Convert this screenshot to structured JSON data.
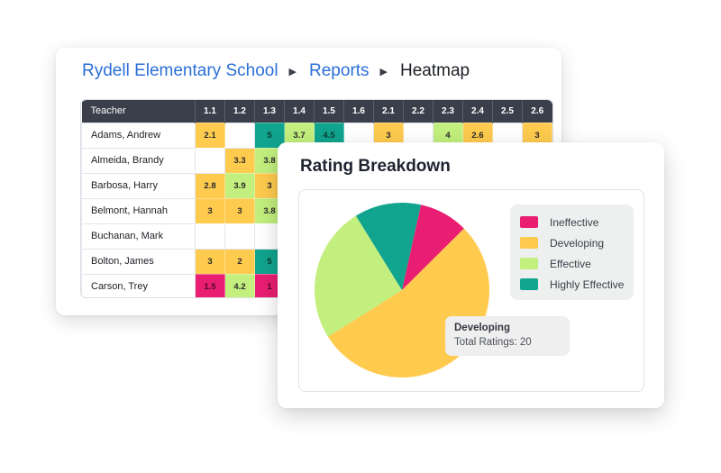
{
  "heatmap_card": {
    "breadcrumb": [
      {
        "label": "Rydell Elementary School",
        "type": "link"
      },
      {
        "label": "Reports",
        "type": "link"
      },
      {
        "label": "Heatmap",
        "type": "current"
      }
    ],
    "separator_icon": "triangle-right-icon",
    "table": {
      "teacher_header": "Teacher",
      "columns": [
        "1.1",
        "1.2",
        "1.3",
        "1.4",
        "1.5",
        "1.6",
        "2.1",
        "2.2",
        "2.3",
        "2.4",
        "2.5",
        "2.6"
      ],
      "rows": [
        {
          "teacher": "Adams, Andrew",
          "scores": [
            "2.1",
            "",
            "5",
            "3.7",
            "4.5",
            "",
            "3",
            "",
            "4",
            "2.6",
            "",
            "3"
          ]
        },
        {
          "teacher": "Almeida, Brandy",
          "scores": [
            "",
            "3.3",
            "3.8",
            "",
            "",
            "",
            "",
            "",
            "",
            "",
            "",
            ""
          ]
        },
        {
          "teacher": "Barbosa, Harry",
          "scores": [
            "2.8",
            "3.9",
            "3",
            "",
            "",
            "",
            "",
            "",
            "",
            "",
            "",
            ""
          ]
        },
        {
          "teacher": "Belmont, Hannah",
          "scores": [
            "3",
            "3",
            "3.8",
            "",
            "",
            "",
            "",
            "",
            "",
            "",
            "",
            ""
          ]
        },
        {
          "teacher": "Buchanan, Mark",
          "scores": [
            "",
            "",
            "",
            "",
            "",
            "",
            "",
            "",
            "",
            "",
            "",
            ""
          ]
        },
        {
          "teacher": "Bolton, James",
          "scores": [
            "3",
            "2",
            "5",
            "",
            "",
            "",
            "",
            "",
            "",
            "",
            "",
            ""
          ]
        },
        {
          "teacher": "Carson, Trey",
          "scores": [
            "1.5",
            "4.2",
            "1",
            "",
            "",
            "",
            "",
            "",
            "",
            "",
            "",
            ""
          ]
        }
      ]
    },
    "colors": {
      "ineffective": "#e91e72",
      "developing": "#fecb4f",
      "effective": "#c2ef7d",
      "highly_effective": "#11a48e",
      "header_bg": "#3a3f4b",
      "link": "#2a6fd6"
    }
  },
  "breakdown_card": {
    "title": "Rating Breakdown",
    "tooltip": {
      "title": "Developing",
      "body": "Total Ratings: 20"
    }
  },
  "chart_data": {
    "type": "pie",
    "title": "Rating Breakdown",
    "start_angle_deg": 12.5,
    "slices": [
      {
        "label": "Ineffective",
        "value": 3.4,
        "color": "#e91e72"
      },
      {
        "label": "Developing",
        "value": 20,
        "color": "#fecb4f"
      },
      {
        "label": "Effective",
        "value": 9.4,
        "color": "#c2ef7d"
      },
      {
        "label": "Highly Effective",
        "value": 4.6,
        "color": "#11a48e"
      }
    ],
    "legend": {
      "position": "right",
      "entries": [
        "Ineffective",
        "Developing",
        "Effective",
        "Highly Effective"
      ]
    },
    "annotation": {
      "slice": "Developing",
      "text": "Total Ratings: 20"
    }
  }
}
